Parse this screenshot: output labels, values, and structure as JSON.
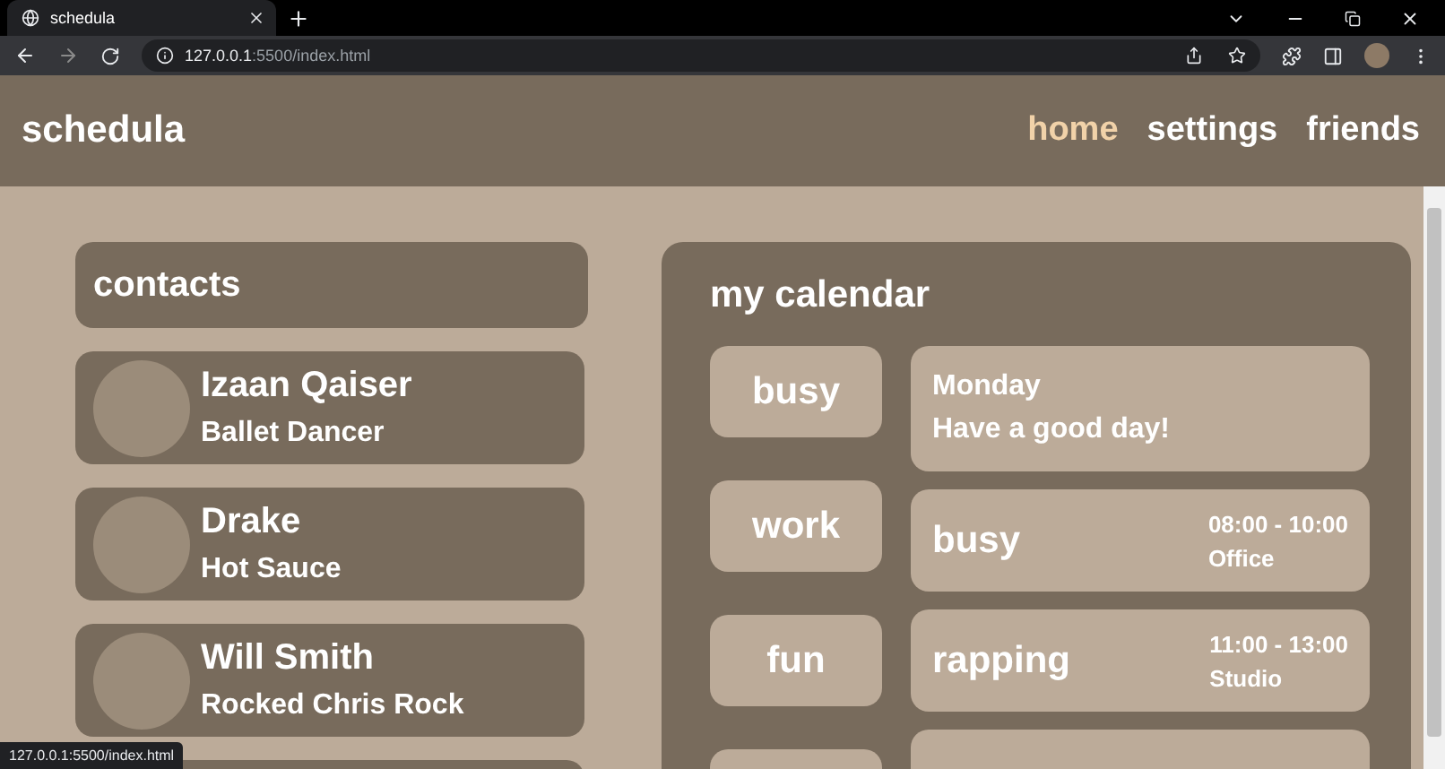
{
  "browser": {
    "tab_title": "schedula",
    "url_host": "127.0.0.1",
    "url_path": ":5500/index.html",
    "status_url": "127.0.0.1:5500/index.html"
  },
  "header": {
    "brand": "schedula",
    "nav": [
      {
        "label": "home",
        "selected": true
      },
      {
        "label": "settings",
        "selected": false
      },
      {
        "label": "friends",
        "selected": false
      }
    ]
  },
  "contacts": {
    "title": "contacts",
    "items": [
      {
        "name": "Izaan Qaiser",
        "role": "Ballet Dancer"
      },
      {
        "name": "Drake",
        "role": "Hot Sauce"
      },
      {
        "name": "Will Smith",
        "role": "Rocked Chris Rock"
      }
    ]
  },
  "calendar": {
    "title": "my calendar",
    "tags": [
      "busy",
      "work",
      "fun"
    ],
    "events": [
      {
        "kind": "note",
        "day": "Monday",
        "message": "Have a good day!"
      },
      {
        "kind": "event",
        "title": "busy",
        "time": "08:00 - 10:00",
        "place": "Office"
      },
      {
        "kind": "event",
        "title": "rapping",
        "time": "11:00 - 13:00",
        "place": "Studio"
      }
    ]
  }
}
